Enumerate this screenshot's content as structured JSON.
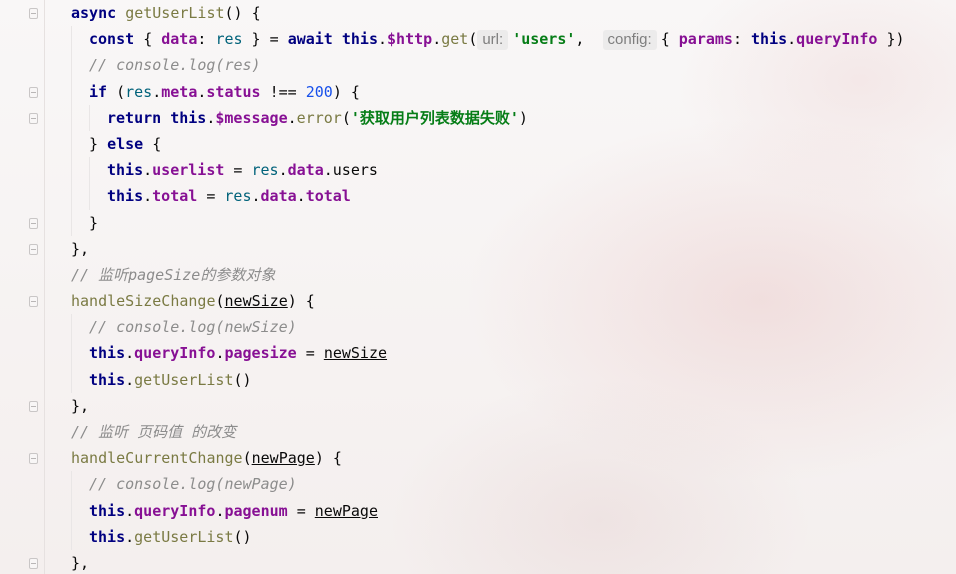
{
  "editor": {
    "lines": [
      {
        "indent": 1,
        "tokens": [
          {
            "t": "async ",
            "c": "kw2"
          },
          {
            "t": "getUserList",
            "c": "fnc"
          },
          {
            "t": "() {",
            "c": "plain"
          }
        ]
      },
      {
        "indent": 2,
        "tokens": [
          {
            "t": "const ",
            "c": "kw2"
          },
          {
            "t": "{ ",
            "c": "plain"
          },
          {
            "t": "data",
            "c": "prop"
          },
          {
            "t": ": ",
            "c": "plain"
          },
          {
            "t": "res",
            "c": "var"
          },
          {
            "t": " } = ",
            "c": "plain"
          },
          {
            "t": "await ",
            "c": "kw2"
          },
          {
            "t": "this",
            "c": "this"
          },
          {
            "t": ".",
            "c": "plain"
          },
          {
            "t": "$http",
            "c": "prop"
          },
          {
            "t": ".",
            "c": "plain"
          },
          {
            "t": "get",
            "c": "fnc"
          },
          {
            "t": "(",
            "c": "plain"
          },
          {
            "t": "url:",
            "c": "hint"
          },
          {
            "t": "'users'",
            "c": "str"
          },
          {
            "t": ",  ",
            "c": "plain"
          },
          {
            "t": "config:",
            "c": "hint"
          },
          {
            "t": "{ ",
            "c": "plain"
          },
          {
            "t": "params",
            "c": "prop"
          },
          {
            "t": ": ",
            "c": "plain"
          },
          {
            "t": "this",
            "c": "this"
          },
          {
            "t": ".",
            "c": "plain"
          },
          {
            "t": "queryInfo",
            "c": "prop"
          },
          {
            "t": " })",
            "c": "plain"
          }
        ]
      },
      {
        "indent": 2,
        "tokens": [
          {
            "t": "// console.log(res)",
            "c": "cm"
          }
        ]
      },
      {
        "indent": 2,
        "tokens": [
          {
            "t": "if ",
            "c": "kw2"
          },
          {
            "t": "(",
            "c": "plain"
          },
          {
            "t": "res",
            "c": "var"
          },
          {
            "t": ".",
            "c": "plain"
          },
          {
            "t": "meta",
            "c": "prop"
          },
          {
            "t": ".",
            "c": "plain"
          },
          {
            "t": "status",
            "c": "prop"
          },
          {
            "t": " !== ",
            "c": "plain"
          },
          {
            "t": "200",
            "c": "num"
          },
          {
            "t": ") {",
            "c": "plain"
          }
        ]
      },
      {
        "indent": 3,
        "tokens": [
          {
            "t": "return ",
            "c": "kw2"
          },
          {
            "t": "this",
            "c": "this"
          },
          {
            "t": ".",
            "c": "plain"
          },
          {
            "t": "$message",
            "c": "prop"
          },
          {
            "t": ".",
            "c": "plain"
          },
          {
            "t": "error",
            "c": "fnc"
          },
          {
            "t": "(",
            "c": "plain"
          },
          {
            "t": "'获取用户列表数据失败'",
            "c": "str"
          },
          {
            "t": ")",
            "c": "plain"
          }
        ]
      },
      {
        "indent": 2,
        "tokens": [
          {
            "t": "} ",
            "c": "plain"
          },
          {
            "t": "else ",
            "c": "kw2"
          },
          {
            "t": "{",
            "c": "plain"
          }
        ]
      },
      {
        "indent": 3,
        "tokens": [
          {
            "t": "this",
            "c": "this"
          },
          {
            "t": ".",
            "c": "plain"
          },
          {
            "t": "userlist",
            "c": "prop"
          },
          {
            "t": " = ",
            "c": "plain"
          },
          {
            "t": "res",
            "c": "var"
          },
          {
            "t": ".",
            "c": "plain"
          },
          {
            "t": "data",
            "c": "prop"
          },
          {
            "t": ".",
            "c": "plain"
          },
          {
            "t": "users",
            "c": "plain"
          }
        ]
      },
      {
        "indent": 3,
        "tokens": [
          {
            "t": "this",
            "c": "this"
          },
          {
            "t": ".",
            "c": "plain"
          },
          {
            "t": "total",
            "c": "prop"
          },
          {
            "t": " = ",
            "c": "plain"
          },
          {
            "t": "res",
            "c": "var"
          },
          {
            "t": ".",
            "c": "plain"
          },
          {
            "t": "data",
            "c": "prop"
          },
          {
            "t": ".",
            "c": "plain"
          },
          {
            "t": "total",
            "c": "prop"
          }
        ]
      },
      {
        "indent": 2,
        "tokens": [
          {
            "t": "}",
            "c": "plain"
          }
        ]
      },
      {
        "indent": 1,
        "tokens": [
          {
            "t": "},",
            "c": "plain"
          }
        ]
      },
      {
        "indent": 1,
        "tokens": [
          {
            "t": "// 监听pageSize的参数对象",
            "c": "cm"
          }
        ]
      },
      {
        "indent": 1,
        "tokens": [
          {
            "t": "handleSizeChange",
            "c": "fnc"
          },
          {
            "t": "(",
            "c": "plain"
          },
          {
            "t": "newSize",
            "c": "param"
          },
          {
            "t": ") {",
            "c": "plain"
          }
        ]
      },
      {
        "indent": 2,
        "tokens": [
          {
            "t": "// console.log(newSize)",
            "c": "cm"
          }
        ]
      },
      {
        "indent": 2,
        "tokens": [
          {
            "t": "this",
            "c": "this"
          },
          {
            "t": ".",
            "c": "plain"
          },
          {
            "t": "queryInfo",
            "c": "prop"
          },
          {
            "t": ".",
            "c": "plain"
          },
          {
            "t": "pagesize",
            "c": "prop"
          },
          {
            "t": " = ",
            "c": "plain"
          },
          {
            "t": "newSize",
            "c": "param"
          }
        ]
      },
      {
        "indent": 2,
        "tokens": [
          {
            "t": "this",
            "c": "this"
          },
          {
            "t": ".",
            "c": "plain"
          },
          {
            "t": "getUserList",
            "c": "fnc"
          },
          {
            "t": "()",
            "c": "plain"
          }
        ]
      },
      {
        "indent": 1,
        "tokens": [
          {
            "t": "},",
            "c": "plain"
          }
        ]
      },
      {
        "indent": 1,
        "tokens": [
          {
            "t": "// 监听 页码值 的改变",
            "c": "cm"
          }
        ]
      },
      {
        "indent": 1,
        "tokens": [
          {
            "t": "handleCurrentChange",
            "c": "fnc"
          },
          {
            "t": "(",
            "c": "plain"
          },
          {
            "t": "newPage",
            "c": "param"
          },
          {
            "t": ") {",
            "c": "plain"
          }
        ]
      },
      {
        "indent": 2,
        "tokens": [
          {
            "t": "// console.log(newPage)",
            "c": "cm"
          }
        ]
      },
      {
        "indent": 2,
        "tokens": [
          {
            "t": "this",
            "c": "this"
          },
          {
            "t": ".",
            "c": "plain"
          },
          {
            "t": "queryInfo",
            "c": "prop"
          },
          {
            "t": ".",
            "c": "plain"
          },
          {
            "t": "pagenum",
            "c": "prop"
          },
          {
            "t": " = ",
            "c": "plain"
          },
          {
            "t": "newPage",
            "c": "param"
          }
        ]
      },
      {
        "indent": 2,
        "tokens": [
          {
            "t": "this",
            "c": "this"
          },
          {
            "t": ".",
            "c": "plain"
          },
          {
            "t": "getUserList",
            "c": "fnc"
          },
          {
            "t": "()",
            "c": "plain"
          }
        ]
      },
      {
        "indent": 1,
        "tokens": [
          {
            "t": "},",
            "c": "plain"
          }
        ]
      }
    ],
    "fold_markers": [
      0,
      3,
      4,
      8,
      9,
      11,
      15,
      17,
      21
    ],
    "colors": {
      "keyword": "#000080",
      "function": "#7a7a43",
      "property": "#871094",
      "string": "#067d17",
      "number": "#1750eb",
      "comment": "#8c8c8c"
    }
  }
}
